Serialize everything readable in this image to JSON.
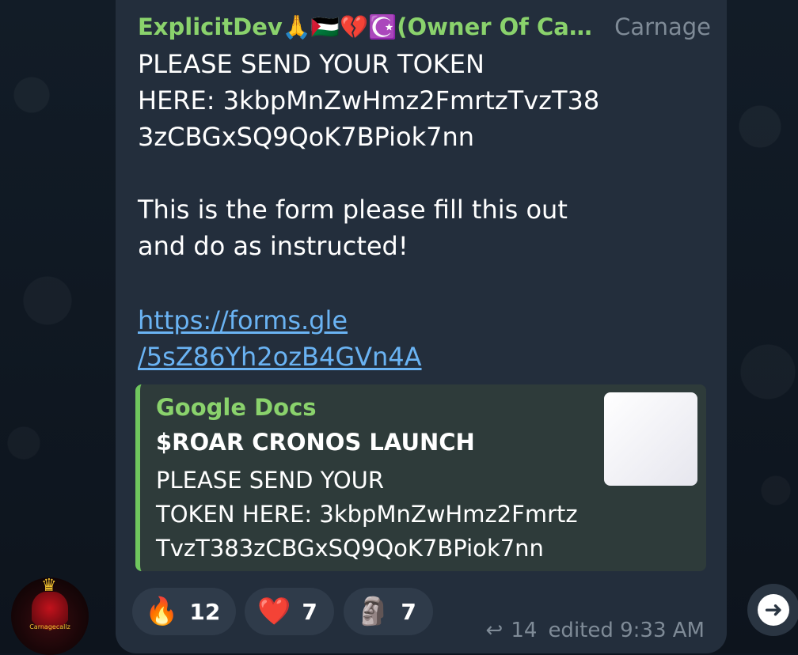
{
  "message": {
    "sender_name": "ExplicitDev🙏🇵🇸💔☪️(Owner Of Carn...",
    "sender_tag": "Carnage",
    "lines_block1": [
      "PLEASE SEND YOUR TOKEN",
      "HERE:  3kbpMnZwHmz2FmrtzTvzT38",
      "3zCBGxSQ9QoK7BPiok7nn"
    ],
    "lines_block2": [
      "This is the form please fill this out",
      "and do as instructed!"
    ],
    "link_lines": [
      "https://forms.gle",
      "/5sZ86Yh2ozB4GVn4A"
    ]
  },
  "preview": {
    "site": "Google Docs",
    "title": "$ROAR CRONOS LAUNCH",
    "desc_lines": [
      "PLEASE SEND YOUR",
      "TOKEN HERE:  3kbpMnZwHmz2Fmrtz",
      "TvzT383zCBGxSQ9QoK7BPiok7nn"
    ]
  },
  "reactions": [
    {
      "emoji": "🔥",
      "count": "12",
      "icon": "fire-icon"
    },
    {
      "emoji": "❤️",
      "count": "7",
      "icon": "heart-icon"
    },
    {
      "emoji": "🗿",
      "count": "7",
      "icon": "moai-icon"
    }
  ],
  "meta": {
    "reply_icon": "↩",
    "views": "14",
    "edited_time": "edited 9:33 AM"
  },
  "avatar": {
    "label": "Carnagecallz",
    "crown": "♛"
  },
  "share": {
    "glyph": "➜"
  },
  "colors": {
    "sender": "#8ad26c",
    "link": "#6ab3f3",
    "bubble": "#232e3c",
    "preview_bar": "#6fc65e"
  }
}
